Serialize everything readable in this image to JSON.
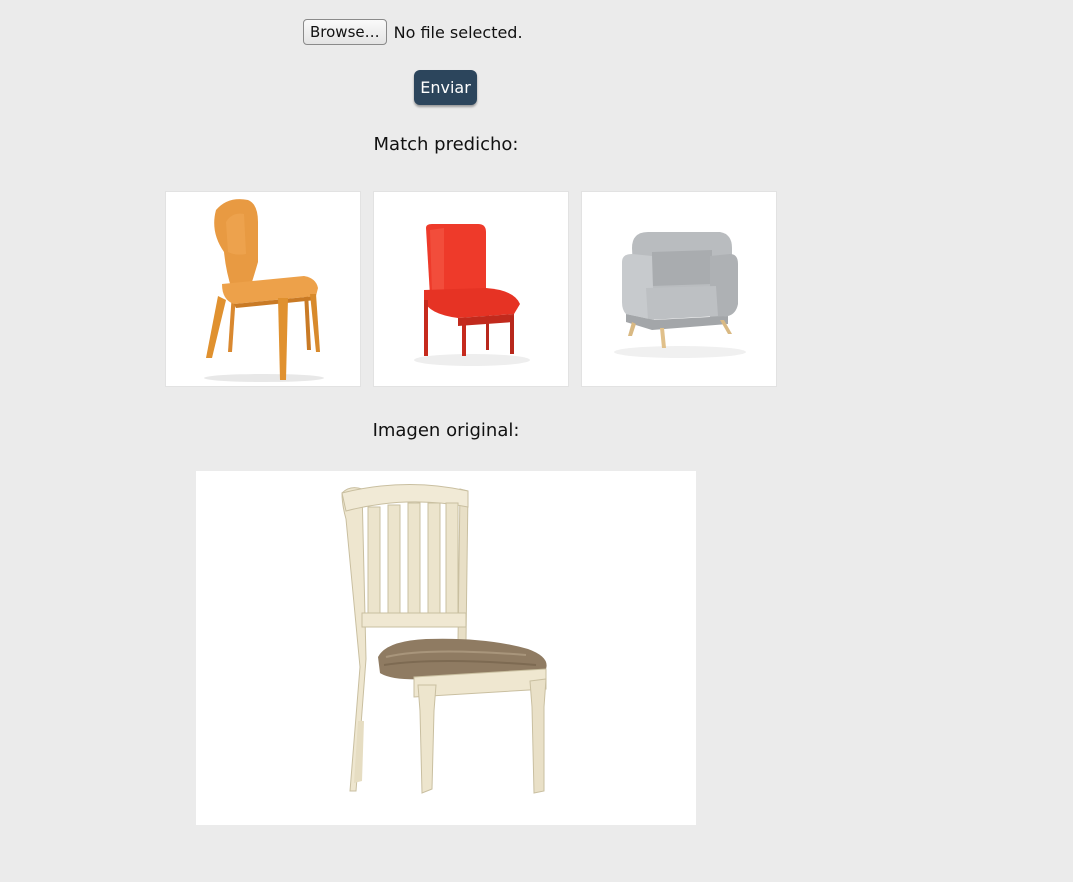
{
  "upload": {
    "browse_label": "Browse…",
    "file_status": "No file selected."
  },
  "submit": {
    "label": "Enviar"
  },
  "colors": {
    "submit_bg": "#2c455c",
    "page_bg": "#ebebeb"
  },
  "match_section": {
    "heading": "Match predicho:",
    "items": [
      {
        "image": "orange-plastic-chair-image"
      },
      {
        "image": "red-upholstered-chair-image"
      },
      {
        "image": "gray-armchair-image"
      }
    ]
  },
  "original_section": {
    "heading": "Imagen original:",
    "image": "cream-wooden-dining-chair-image"
  }
}
